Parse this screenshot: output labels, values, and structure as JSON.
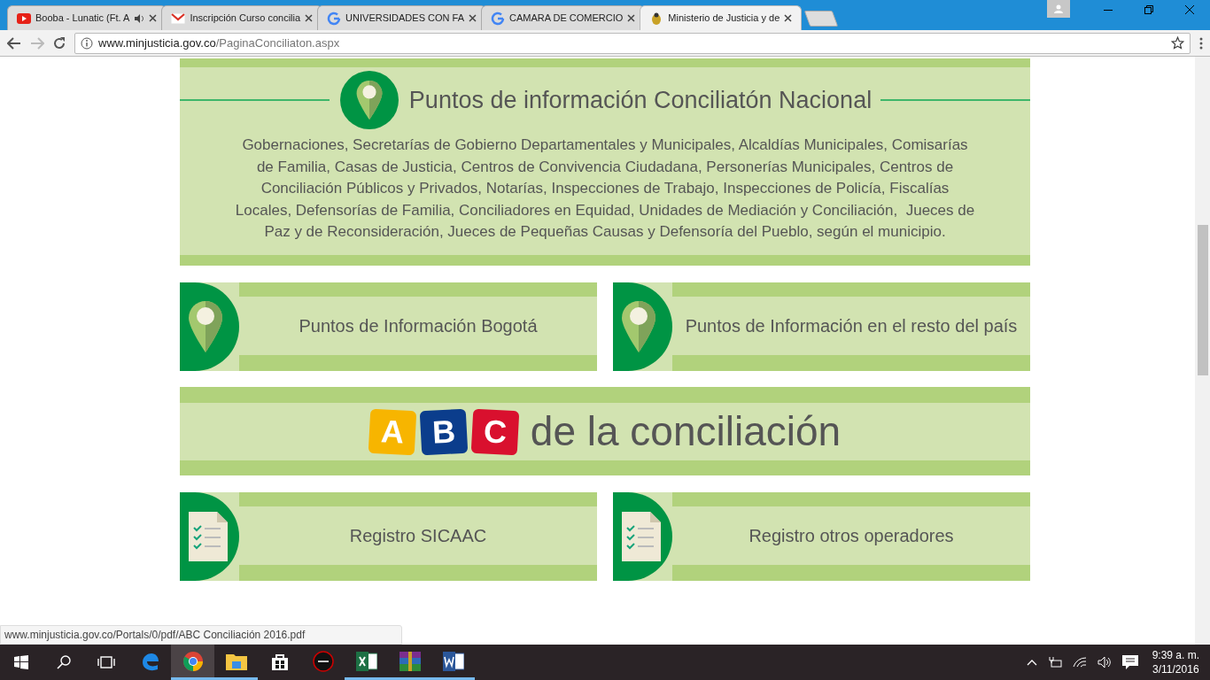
{
  "tabs": [
    {
      "title": "Booba - Lunatic (Ft. A",
      "kind": "youtube",
      "audio": true,
      "selected": false
    },
    {
      "title": "Inscripción Curso concilia",
      "kind": "gmail",
      "audio": false,
      "selected": false
    },
    {
      "title": "UNIVERSIDADES CON FA",
      "kind": "google",
      "audio": false,
      "selected": false
    },
    {
      "title": "CAMARA DE COMERCIO",
      "kind": "google",
      "audio": false,
      "selected": false
    },
    {
      "title": "Ministerio de Justicia y de",
      "kind": "crest",
      "audio": false,
      "selected": true
    }
  ],
  "address": {
    "domain": "www.minjusticia.gov.co",
    "path": "/PaginaConciliaton.aspx"
  },
  "national": {
    "title": "Puntos de información Conciliatón Nacional",
    "text": "Gobernaciones, Secretarías de Gobierno Departamentales y Municipales, Alcaldías Municipales, Comisarías de Familia, Casas de Justicia, Centros de Convivencia Ciudadana, Personerías Municipales, Centros de Conciliación Públicos y Privados, Notarías, Inspecciones de Trabajo, Inspecciones de Policía, Fiscalías Locales, Defensorías de Familia, Conciliadores en Equidad, Unidades de Mediación y Conciliación,  Jueces de Paz y de Reconsideración, Jueces de Pequeñas Causas y Defensoría del Pueblo, según el municipio."
  },
  "info_cards": [
    {
      "label": "Puntos de Información Bogotá",
      "kind": "pin"
    },
    {
      "label": "Puntos de Información en el resto del país",
      "kind": "pin"
    }
  ],
  "abc": {
    "letters": [
      {
        "letter": "A",
        "color": "#f7b500"
      },
      {
        "letter": "B",
        "color": "#0b3d8c"
      },
      {
        "letter": "C",
        "color": "#d9102e"
      }
    ],
    "text": "de la conciliación"
  },
  "register_cards": [
    {
      "label": "Registro SICAAC",
      "kind": "document"
    },
    {
      "label": "Registro otros operadores",
      "kind": "document"
    }
  ],
  "status_link": "www.minjusticia.gov.co/Portals/0/pdf/ABC Conciliación 2016.pdf",
  "taskbar": [
    {
      "kind": "edge",
      "running": false,
      "selected": false
    },
    {
      "kind": "chrome",
      "running": true,
      "selected": true
    },
    {
      "kind": "explorer",
      "running": true,
      "selected": false
    },
    {
      "kind": "store",
      "running": false,
      "selected": false
    },
    {
      "kind": "asus",
      "running": false,
      "selected": false
    },
    {
      "kind": "excel",
      "running": true,
      "selected": false
    },
    {
      "kind": "winrar",
      "running": true,
      "selected": false
    },
    {
      "kind": "word",
      "running": true,
      "selected": false
    }
  ],
  "clock": {
    "time": "9:39 a. m.",
    "date": "3/11/2016"
  }
}
